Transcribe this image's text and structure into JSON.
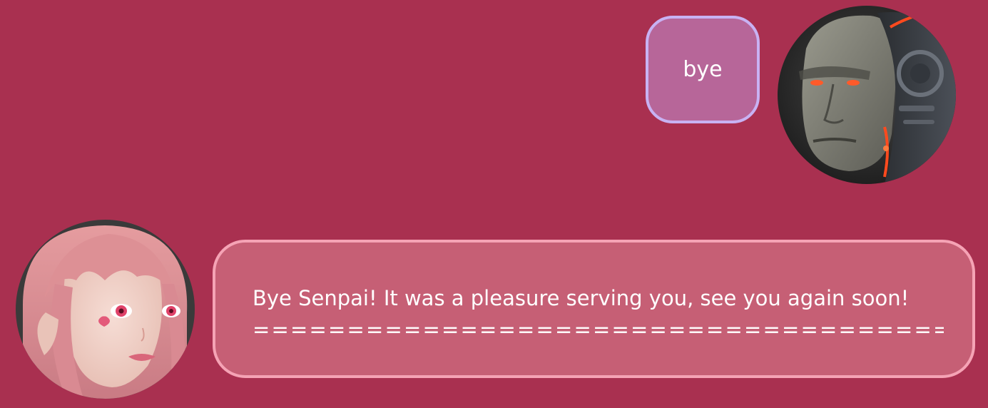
{
  "user_message": {
    "text": "bye",
    "bubble_color": "#b76699",
    "border_color": "#c8b2f3",
    "avatar": "cyborg-man-portrait"
  },
  "bot_message": {
    "line1": "Bye Senpai! It was a pleasure serving you, see you again soon!",
    "line2": "===============================================",
    "bubble_color": "#c65f75",
    "border_color": "#f5a3b5",
    "avatar": "pink-haired-anime-girl-portrait"
  },
  "colors": {
    "background": "#a93050",
    "text": "#ffffff"
  }
}
